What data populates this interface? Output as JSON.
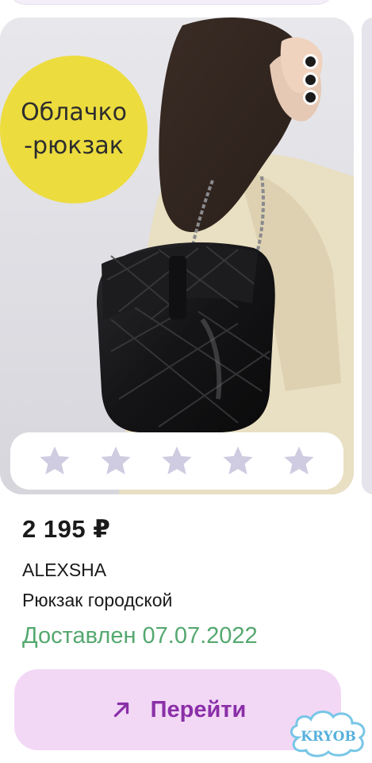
{
  "card": {
    "sticker": {
      "line1": "Облачко",
      "line2": "-рюкзак"
    },
    "menu_icon": "more-vertical-icon",
    "rating": {
      "stars_total": 5,
      "stars_filled": 0,
      "star_icon": "star-icon",
      "star_color": "#cfcbe0"
    }
  },
  "product": {
    "price": "2 195 ₽",
    "brand": "ALEXSHA",
    "name": "Рюкзак городской",
    "delivery_status": "Доставлен 07.07.2022"
  },
  "action": {
    "icon": "arrow-up-right-icon",
    "label": "Перейти",
    "background": "#f3d8f6",
    "color": "#8a2fa8"
  },
  "watermark": {
    "text": "KRYOB"
  },
  "colors": {
    "accent": "#8a2fa8",
    "status_green": "#54a86f",
    "sticker_yellow": "#eddc3e"
  }
}
